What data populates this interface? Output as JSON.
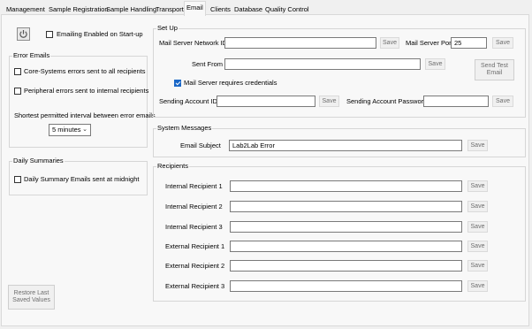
{
  "tabs": [
    {
      "label": "Management"
    },
    {
      "label": "Sample Registration"
    },
    {
      "label": "Sample Handling"
    },
    {
      "label": "Transport"
    },
    {
      "label": "Email"
    },
    {
      "label": "Clients"
    },
    {
      "label": "Database"
    },
    {
      "label": "Quality Control"
    }
  ],
  "active_tab": "Email",
  "left": {
    "power_icon": "power-icon",
    "emailing_enabled_label": "Emailing Enabled on Start-up",
    "emailing_enabled_checked": false,
    "error_emails": {
      "title": "Error Emails",
      "core_label": "Core-Systems errors sent to all recipients",
      "core_checked": false,
      "peripheral_label": "Peripheral errors sent to internal recipients",
      "peripheral_checked": false,
      "interval_label": "Shortest permitted interval between error emails",
      "interval_value": "5 minutes"
    },
    "daily": {
      "title": "Daily Summaries",
      "label": "Daily Summary Emails sent at midnight",
      "checked": false
    },
    "restore_button": "Restore Last\nSaved Values"
  },
  "setup": {
    "title": "Set Up",
    "server_id_label": "Mail Server Network ID",
    "server_id_value": "",
    "server_port_label": "Mail Server Port",
    "server_port_value": "25",
    "sent_from_label": "Sent From",
    "sent_from_value": "",
    "requires_credentials_label": "Mail Server requires credentials",
    "requires_credentials_checked": true,
    "account_id_label": "Sending Account ID",
    "account_id_value": "",
    "account_password_label": "Sending Account Password",
    "account_password_value": "",
    "send_test_button": "Send Test\nEmail",
    "save_label": "Save"
  },
  "system_messages": {
    "title": "System Messages",
    "subject_label": "Email Subject",
    "subject_value": "Lab2Lab Error",
    "save_label": "Save"
  },
  "recipients": {
    "title": "Recipients",
    "save_label": "Save",
    "items": [
      {
        "label": "Internal Recipient 1",
        "value": ""
      },
      {
        "label": "Internal Recipient 2",
        "value": ""
      },
      {
        "label": "Internal Recipient 3",
        "value": ""
      },
      {
        "label": "External Recipient 1",
        "value": ""
      },
      {
        "label": "External Recipient 2",
        "value": ""
      },
      {
        "label": "External Recipient 3",
        "value": ""
      }
    ]
  }
}
